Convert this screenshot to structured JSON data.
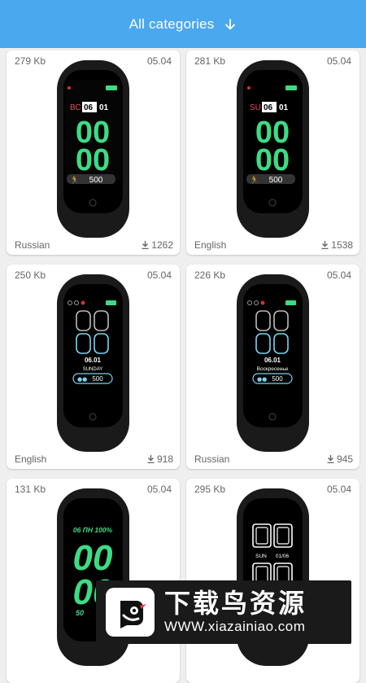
{
  "header": {
    "title": "All categories"
  },
  "cards": [
    {
      "size": "279 Kb",
      "date": "05.04",
      "language": "Russian",
      "downloads": "1262"
    },
    {
      "size": "281 Kb",
      "date": "05.04",
      "language": "English",
      "downloads": "1538"
    },
    {
      "size": "250 Kb",
      "date": "05.04",
      "language": "English",
      "downloads": "918"
    },
    {
      "size": "226 Kb",
      "date": "05.04",
      "language": "Russian",
      "downloads": "945"
    },
    {
      "size": "131 Kb",
      "date": "05.04"
    },
    {
      "size": "295 Kb",
      "date": "05.04"
    }
  ],
  "faces": {
    "f1": {
      "day": "ВС",
      "date": "06",
      "month": "01",
      "hours": "00",
      "minutes": "00",
      "steps": "500"
    },
    "f2": {
      "day": "SU",
      "date": "06",
      "month": "01",
      "hours": "00",
      "minutes": "00",
      "steps": "500"
    },
    "f3": {
      "date": "06.01",
      "weekday": "SUNDAY",
      "steps": "500"
    },
    "f4": {
      "date": "06.01",
      "weekday": "Воскресенье",
      "steps": "500"
    },
    "f5": {
      "top": "06 ПН 100%",
      "hours": "00",
      "minutes": "00",
      "steps": "50"
    },
    "f6": {
      "day": "SUN",
      "date": "01/06"
    }
  },
  "banner": {
    "cn_text": "下载鸟资源",
    "url": "WWW.xiazainiao.com"
  },
  "colors": {
    "header": "#4aa8ee",
    "green": "#3ddc84",
    "card": "#ffffff",
    "background": "#efefef"
  }
}
